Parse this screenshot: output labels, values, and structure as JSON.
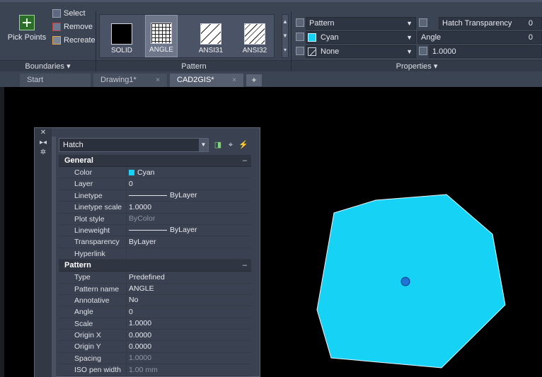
{
  "boundaries": {
    "pick_points_label": "Pick Points",
    "select_label": "Select",
    "remove_label": "Remove",
    "recreate_label": "Recreate",
    "panel_title": "Boundaries ▾"
  },
  "pattern": {
    "panel_title": "Pattern",
    "swatches": [
      {
        "name": "SOLID"
      },
      {
        "name": "ANGLE"
      },
      {
        "name": "ANSI31"
      },
      {
        "name": "ANSI32"
      }
    ],
    "selected": "ANGLE"
  },
  "properties": {
    "panel_title": "Properties ▾",
    "type_value": "Pattern",
    "color_value": "Cyan",
    "background_value": "None",
    "transparency_label": "Hatch Transparency",
    "transparency_value": "0",
    "angle_label": "Angle",
    "angle_value": "0",
    "scale_value": "1.0000"
  },
  "tabs": {
    "items": [
      {
        "label": "Start"
      },
      {
        "label": "Drawing1*"
      },
      {
        "label": "CAD2GIS*"
      }
    ],
    "close_glyph": "×",
    "plus_glyph": "+"
  },
  "palette": {
    "selection": "Hatch",
    "general": {
      "title": "General",
      "rows": [
        {
          "k": "Color",
          "v": "Cyan"
        },
        {
          "k": "Layer",
          "v": "0"
        },
        {
          "k": "Linetype",
          "v": "ByLayer"
        },
        {
          "k": "Linetype scale",
          "v": "1.0000"
        },
        {
          "k": "Plot style",
          "v": "ByColor"
        },
        {
          "k": "Lineweight",
          "v": "ByLayer"
        },
        {
          "k": "Transparency",
          "v": "ByLayer"
        },
        {
          "k": "Hyperlink",
          "v": ""
        }
      ]
    },
    "pattern": {
      "title": "Pattern",
      "rows": [
        {
          "k": "Type",
          "v": "Predefined"
        },
        {
          "k": "Pattern name",
          "v": "ANGLE"
        },
        {
          "k": "Annotative",
          "v": "No"
        },
        {
          "k": "Angle",
          "v": "0"
        },
        {
          "k": "Scale",
          "v": "1.0000"
        },
        {
          "k": "Origin X",
          "v": "0.0000"
        },
        {
          "k": "Origin Y",
          "v": "0.0000"
        },
        {
          "k": "Spacing",
          "v": "1.0000"
        },
        {
          "k": "ISO pen width",
          "v": "1.00 mm"
        }
      ]
    },
    "collapse_glyph": "–"
  },
  "colors": {
    "hatch_fill": "#16d3f5",
    "grip": "#1f74d6",
    "ribbon_bg": "#3b4453"
  }
}
